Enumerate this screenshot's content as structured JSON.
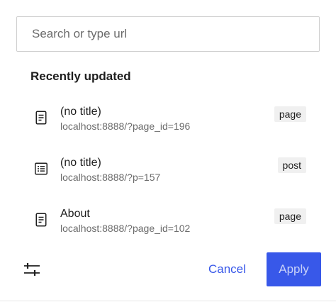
{
  "search": {
    "value": "",
    "placeholder": "Search or type url"
  },
  "section_title": "Recently updated",
  "results": [
    {
      "title": "(no title)",
      "url": "localhost:8888/?page_id=196",
      "type": "page",
      "icon": "page-icon"
    },
    {
      "title": "(no title)",
      "url": "localhost:8888/?p=157",
      "type": "post",
      "icon": "post-list-icon"
    },
    {
      "title": "About",
      "url": "localhost:8888/?page_id=102",
      "type": "page",
      "icon": "page-icon"
    }
  ],
  "footer": {
    "settings_icon": "sliders-icon",
    "cancel_label": "Cancel",
    "apply_label": "Apply"
  },
  "colors": {
    "accent": "#3858e9",
    "apply_text_disabled": "#c8d1f8",
    "badge_bg": "#f0f0f0",
    "muted_text": "#6b6b6b"
  }
}
